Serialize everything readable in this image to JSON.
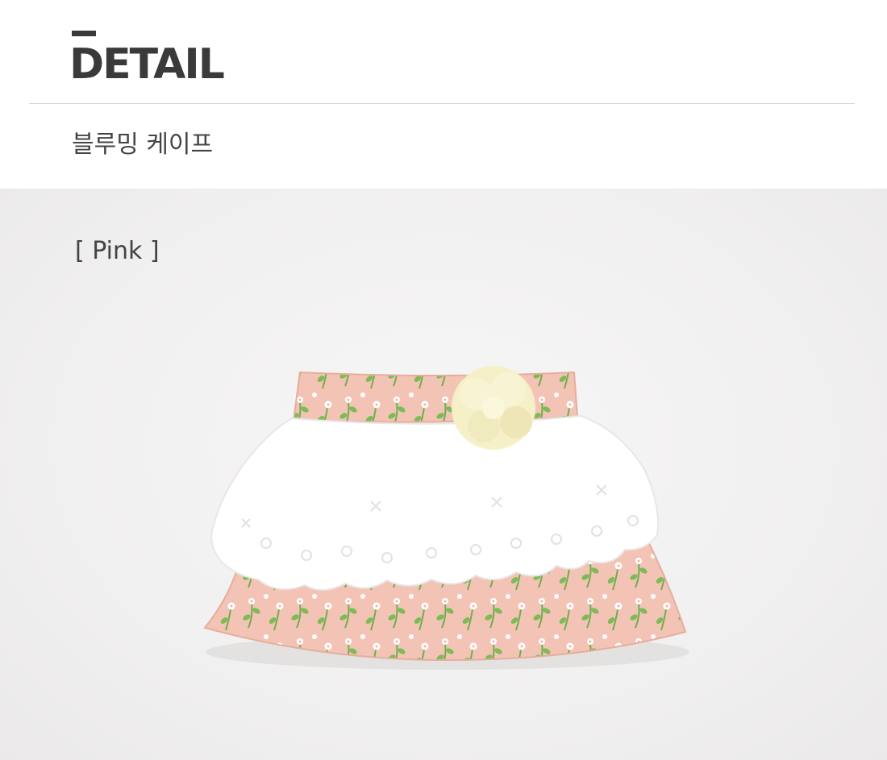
{
  "header": {
    "title": "DETAIL",
    "product_name": "블루밍 케이프"
  },
  "photo": {
    "variant_label": "[ Pink ]"
  },
  "colors": {
    "fabric_pink": "#f3c6b8",
    "lace_white": "#ffffff",
    "leaf_green": "#6fae4a",
    "flower_cream": "#f6f0c8",
    "title_dark": "#3a3a3a"
  }
}
